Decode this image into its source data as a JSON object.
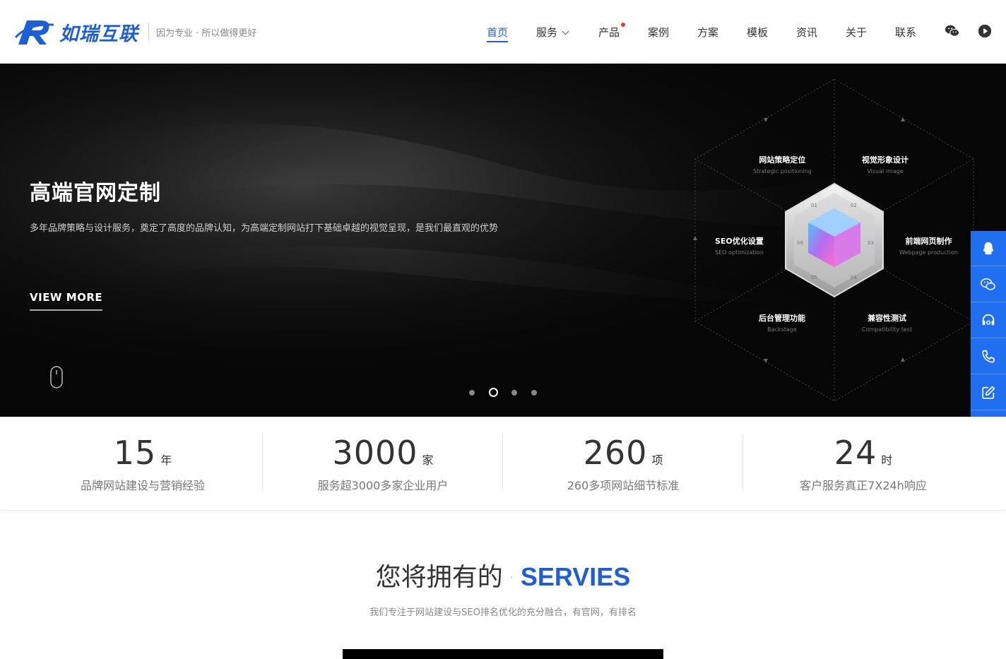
{
  "brand": {
    "name": "如瑞互联",
    "slogan": "因为专业 · 所以做得更好",
    "color": "#1f5fd6"
  },
  "nav": {
    "items": [
      {
        "label": "首页",
        "active": true
      },
      {
        "label": "服务",
        "dropdown": true
      },
      {
        "label": "产品",
        "badge": true
      },
      {
        "label": "案例"
      },
      {
        "label": "方案"
      },
      {
        "label": "模板"
      },
      {
        "label": "资讯"
      },
      {
        "label": "关于"
      },
      {
        "label": "联系"
      }
    ],
    "icons": [
      "wechat-icon",
      "play-icon"
    ]
  },
  "hero": {
    "title": "高端官网定制",
    "subtitle": "多年品牌策略与设计服务，奠定了高度的品牌认知，为高端定制网站打下基础卓越的视觉呈现，是我们最直观的优势",
    "cta": "VIEW MORE",
    "slides": 4,
    "active_slide": 2,
    "diagram": {
      "labels": [
        {
          "zh": "网站策略定位",
          "en": "Strategic positioning"
        },
        {
          "zh": "视觉形象设计",
          "en": "Visual image"
        },
        {
          "zh": "SEO优化设置",
          "en": "SEO optimization"
        },
        {
          "zh": "前端网页制作",
          "en": "Webpage production"
        },
        {
          "zh": "后台管理功能",
          "en": "Backstage"
        },
        {
          "zh": "兼容性测试",
          "en": "Compatibility test"
        }
      ],
      "cube_numbers": [
        "01",
        "02",
        "03",
        "04",
        "05",
        "06"
      ]
    }
  },
  "side_bar": {
    "color": "#1f6ff0",
    "icons": [
      "qq-icon",
      "wechat-icon",
      "headset-icon",
      "phone-icon",
      "edit-icon",
      "arrow-up-icon"
    ]
  },
  "stats": [
    {
      "num": "15",
      "unit": "年",
      "desc": "品牌网站建设与营销经验"
    },
    {
      "num": "3000",
      "unit": "家",
      "desc": "服务超3000多家企业用户"
    },
    {
      "num": "260",
      "unit": "项",
      "desc": "260多项网站细节标准"
    },
    {
      "num": "24",
      "unit": "时",
      "desc": "客户服务真正7X24h响应"
    }
  ],
  "services": {
    "title_zh": "您将拥有的",
    "title_sep": "·",
    "title_en": "SERVIES",
    "subtitle": "我们专注于网站建设与SEO排名优化的充分融合，有官网，有排名"
  }
}
